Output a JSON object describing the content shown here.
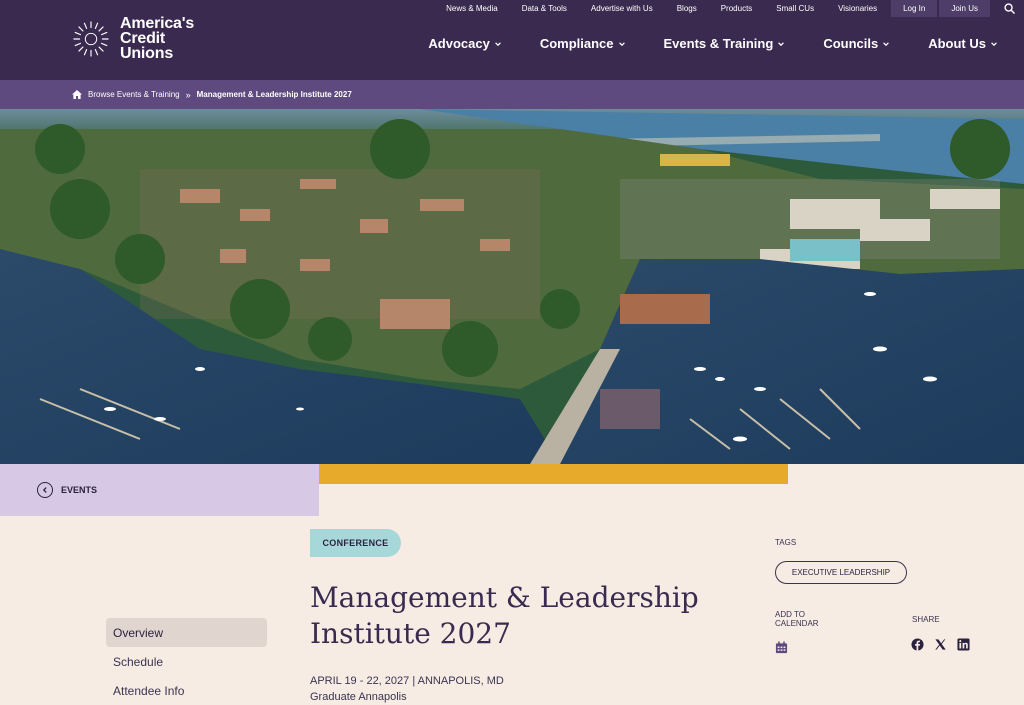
{
  "logo": {
    "line1": "America's",
    "line2": "Credit",
    "line3": "Unions"
  },
  "utility_nav": {
    "items": [
      "News & Media",
      "Data & Tools",
      "Advertise with Us",
      "Blogs",
      "Products",
      "Small CUs",
      "Visionaries"
    ],
    "login": "Log In",
    "join": "Join Us"
  },
  "main_nav": {
    "items": [
      "Advocacy",
      "Compliance",
      "Events & Training",
      "Councils",
      "About Us"
    ]
  },
  "breadcrumb": {
    "parent": "Browse Events & Training",
    "separator": "»",
    "current": "Management & Leadership Institute 2027"
  },
  "back_link": {
    "label": "EVENTS"
  },
  "event": {
    "type": "CONFERENCE",
    "title_line1": "Management & Leadership",
    "title_line2": "Institute 2027",
    "dates": "APRIL 19 - 22, 2027 | ANNAPOLIS, MD",
    "venue": "Graduate Annapolis"
  },
  "sidebar": {
    "items": [
      {
        "label": "Overview",
        "active": true
      },
      {
        "label": "Schedule",
        "active": false
      },
      {
        "label": "Attendee Info",
        "active": false
      }
    ]
  },
  "tags": {
    "label": "TAGS",
    "items": [
      "EXECUTIVE LEADERSHIP"
    ]
  },
  "calendar": {
    "label_line1": "ADD TO",
    "label_line2": "CALENDAR",
    "icon": "calendar-icon"
  },
  "share": {
    "label": "SHARE",
    "icons": [
      "facebook-icon",
      "x-icon",
      "linkedin-icon"
    ]
  },
  "colors": {
    "header": "#3b2a4f",
    "breadcrumb_bar": "#5e4a7e",
    "page_bg": "#f6ece4",
    "accent_gold": "#e8aa2a",
    "badge_teal": "#a7d8d9",
    "back_strip": "#d7c8e5"
  }
}
